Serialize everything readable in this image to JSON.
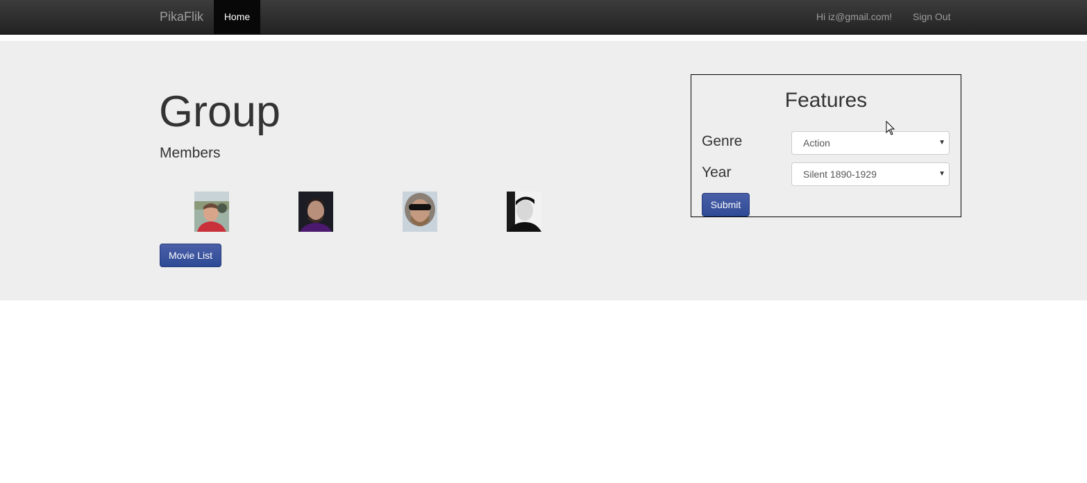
{
  "navbar": {
    "brand": "PikaFlik",
    "home": "Home",
    "greeting": "Hi iz@gmail.com!",
    "sign_out": "Sign Out"
  },
  "main": {
    "title": "Group",
    "members_label": "Members",
    "movie_list_button": "Movie List",
    "avatars": [
      "avatar-icon",
      "avatar-icon",
      "avatar-icon",
      "avatar-icon"
    ]
  },
  "features": {
    "title": "Features",
    "genre_label": "Genre",
    "genre_value": "Action",
    "year_label": "Year",
    "year_value": "Silent 1890-1929",
    "submit": "Submit"
  },
  "colors": {
    "navbar": "#222222",
    "jumbotron": "#eeeeee",
    "primary": "#2e4b95"
  }
}
